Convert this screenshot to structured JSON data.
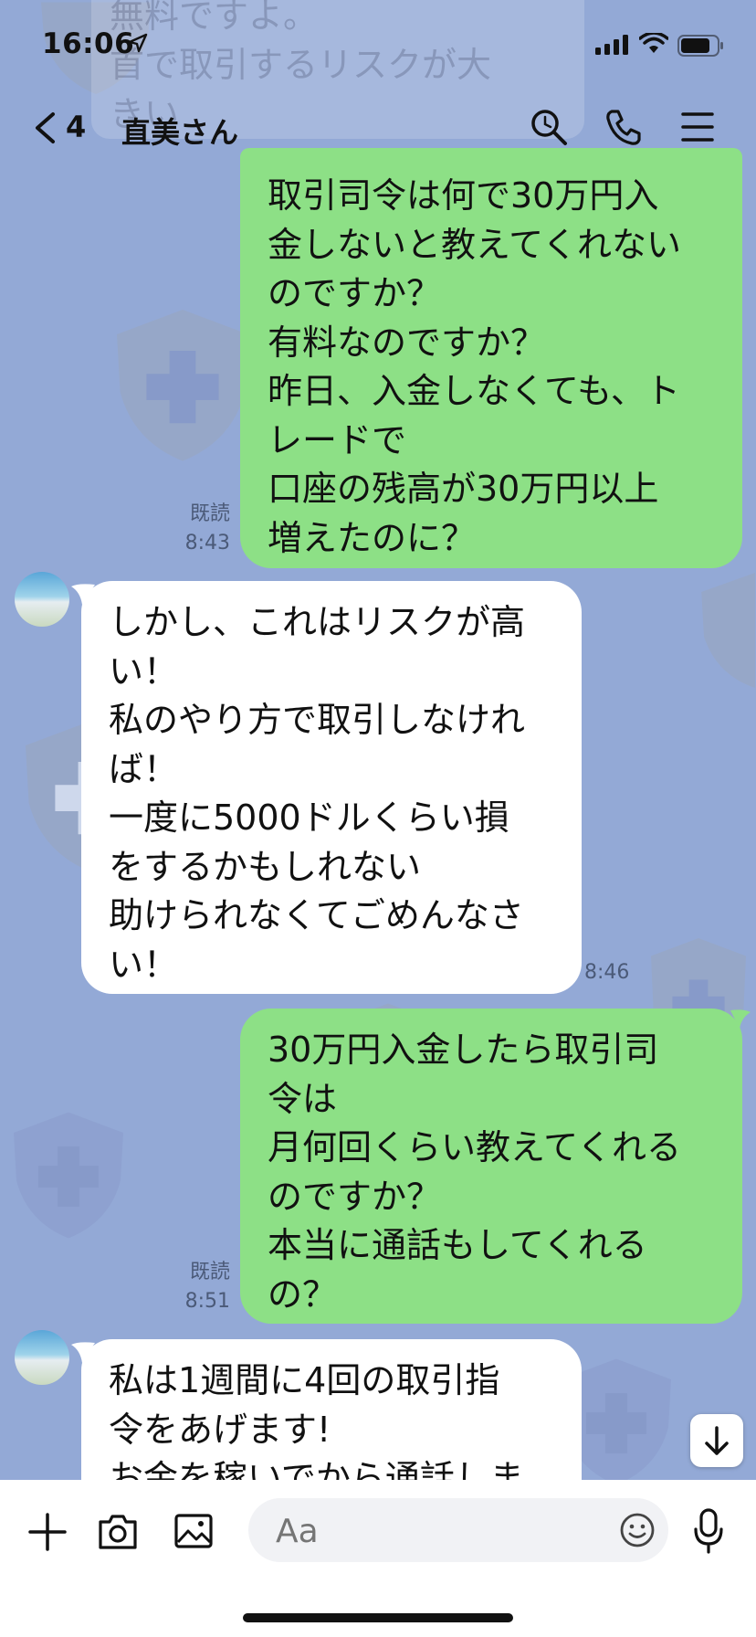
{
  "status_bar": {
    "time": "16:06"
  },
  "ghost_preview": {
    "text": "無料ですよ。\n首で取引するリスクが大\nきい"
  },
  "header": {
    "back_count": "4",
    "title": "直美さん"
  },
  "messages": [
    {
      "side": "out",
      "text": "取引司令は何で30万円入\n金しないと教えてくれない\nのですか？\n有料なのですか？\n昨日、入金しなくても、ト\nレードで\n口座の残高が30万円以上\n増えたのに？",
      "read": "既読",
      "time": "8:43"
    },
    {
      "side": "in",
      "text": "しかし、これはリスクが高\nい！\n私のやり方で取引しなけれ\nば！\n一度に5000ドルくらい損\nをするかもしれない\n助けられなくてごめんなさ\nい！",
      "time": "8:46"
    },
    {
      "side": "out",
      "text": "30万円入金したら取引司\n令は\n月何回くらい教えてくれる\nのですか？\n本当に通話もしてくれる\nの？",
      "read": "既読",
      "time": "8:51"
    },
    {
      "side": "in",
      "text": "私は1週間に4回の取引指\n令をあげます!\nお金を稼いでから通話しま"
    }
  ],
  "composer": {
    "placeholder": "Aa"
  },
  "colors": {
    "chat_bg": "#93a9d6",
    "outgoing_bubble": "#8de086",
    "incoming_bubble": "#ffffff"
  }
}
